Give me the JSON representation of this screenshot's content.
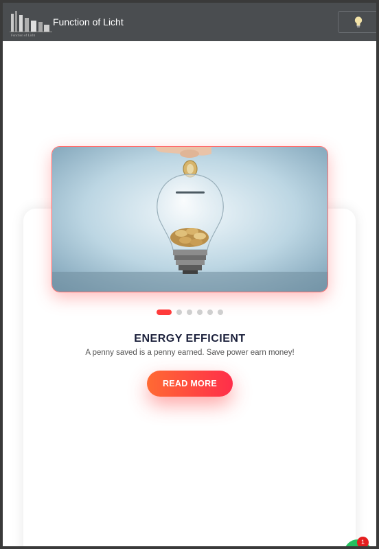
{
  "navbar": {
    "brand": "Function of Licht",
    "logo_icon": "building-logo-icon",
    "theme_icon": "lightbulb-icon"
  },
  "slider": {
    "hero_image": "lightbulb-with-coins-image",
    "active_index": 0,
    "slide_count": 6,
    "title": "ENERGY EFFICIENT",
    "description": "A penny saved is a penny earned. Save power earn money!",
    "button_label": "READ MORE"
  },
  "chat": {
    "badge_count": "1",
    "icon": "chat-icon"
  },
  "colors": {
    "navbar": "#4a4d50",
    "accent": "#ff3b3b",
    "button_start": "#ff6a33",
    "button_end": "#ff2e4a",
    "title": "#1a1f3a"
  }
}
